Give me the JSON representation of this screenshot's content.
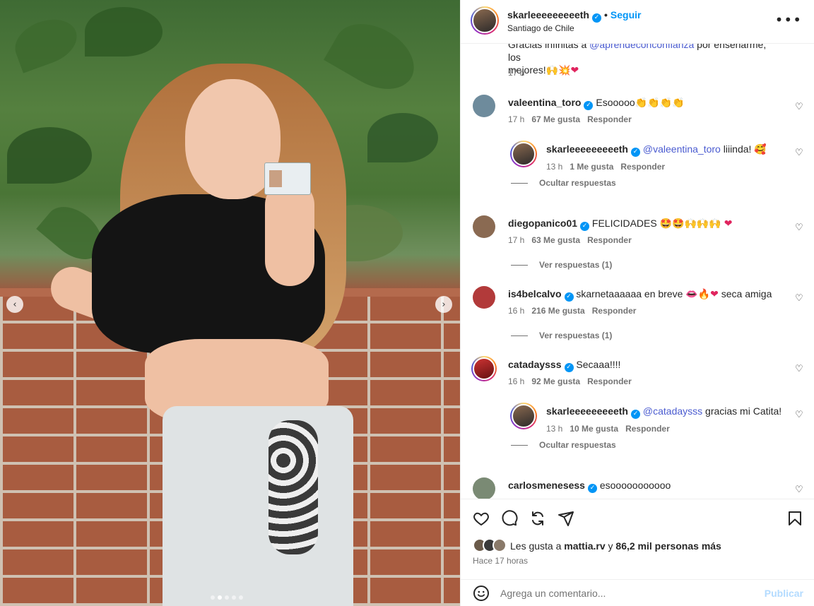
{
  "post": {
    "author": "skarleeeeeeeeeth",
    "follow_label": "Seguir",
    "separator": "•",
    "location": "Santiago de Chile",
    "more_icon": "more-horizontal-icon",
    "carousel": {
      "slide_count": 5,
      "active_slide": 2
    }
  },
  "caption": {
    "line1_start": "Gracias infinitas a ",
    "line1_mention": "@aprendeconconfianza",
    "line1_end": " por enseñarme, los",
    "line2": "mejores!",
    "line2_emoji": "🙌💥❤",
    "time": "17 h"
  },
  "comments": [
    {
      "user": "valeentina_toro",
      "text": "Esooooo",
      "emoji": "👏👏👏👏",
      "time": "17 h",
      "likes": "67 Me gusta",
      "reply_label": "Responder",
      "reply": {
        "user": "skarleeeeeeeeeth",
        "mention": "@valeentina_toro",
        "text": " liiinda! ",
        "emoji": "🥰",
        "time": "13 h",
        "likes": "1 Me gusta",
        "reply_label": "Responder"
      },
      "toggle_label": "Ocultar respuestas"
    },
    {
      "user": "diegopanico01",
      "text": "FELICIDADES ",
      "emoji": "🤩🤩🙌🙌🙌",
      "emoji2": "❤",
      "time": "17 h",
      "likes": "63 Me gusta",
      "reply_label": "Responder",
      "toggle_label": "Ver respuestas (1)"
    },
    {
      "user": "is4belcalvo",
      "text": "skarnetaaaaaa en breve ",
      "emoji": "👄🔥❤",
      "text2": " seca amiga",
      "time": "16 h",
      "likes": "216 Me gusta",
      "reply_label": "Responder",
      "toggle_label": "Ver respuestas (1)"
    },
    {
      "user": "catadaysss",
      "text": "Secaaa!!!!",
      "time": "16 h",
      "likes": "92 Me gusta",
      "reply_label": "Responder",
      "reply": {
        "user": "skarleeeeeeeeeth",
        "mention": "@catadaysss",
        "text": " gracias mi Catita!",
        "time": "13 h",
        "likes": "10 Me gusta",
        "reply_label": "Responder"
      },
      "toggle_label": "Ocultar respuestas"
    },
    {
      "user": "carlosmenesess",
      "text": "esooooooooooo"
    }
  ],
  "actions": {
    "like_icon": "heart-icon",
    "comment_icon": "comment-icon",
    "share_icon": "repost-icon",
    "send_icon": "send-icon",
    "save_icon": "bookmark-icon",
    "likes_prefix": "Les gusta a ",
    "likes_user": "mattia.rv",
    "likes_middle": " y ",
    "likes_count": "86,2 mil personas más",
    "posted": "Hace 17 horas"
  },
  "add_comment": {
    "placeholder": "Agrega un comentario...",
    "publish_label": "Publicar"
  },
  "verified_glyph": "✓",
  "arrows": {
    "prev": "‹",
    "next": "›"
  },
  "heart_outline": "♡",
  "colors": {
    "link": "#0095f6",
    "mention": "#4a5bd0",
    "muted": "#737373"
  }
}
